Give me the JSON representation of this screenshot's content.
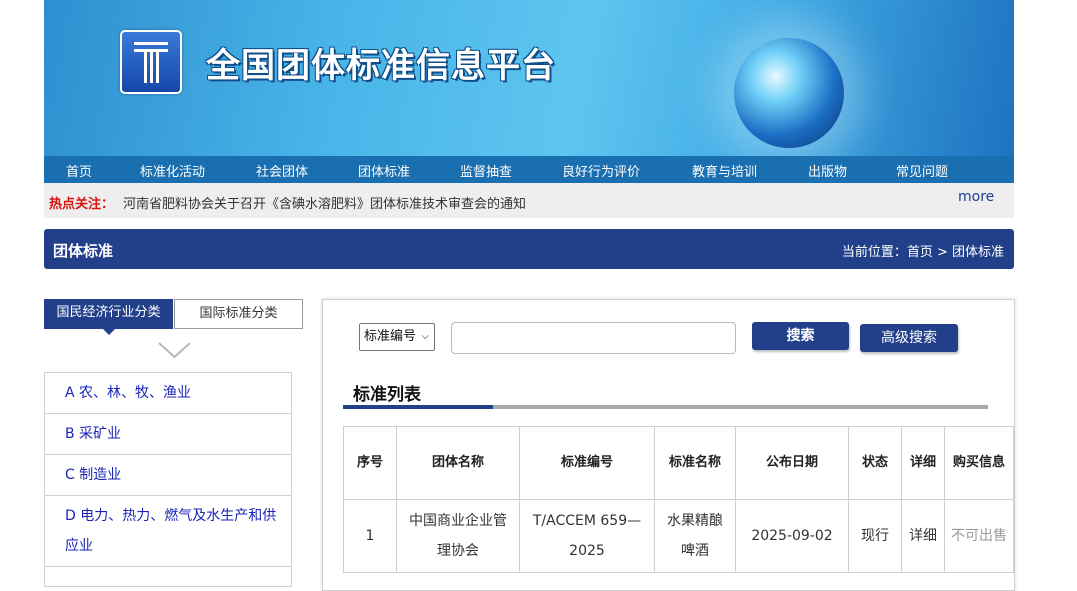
{
  "banner": {
    "site_title": "全国团体标准信息平台"
  },
  "nav": [
    {
      "label": "首页"
    },
    {
      "label": "标准化活动"
    },
    {
      "label": "社会团体"
    },
    {
      "label": "团体标准"
    },
    {
      "label": "监督抽查"
    },
    {
      "label": "良好行为评价"
    },
    {
      "label": "教育与培训"
    },
    {
      "label": "出版物"
    },
    {
      "label": "常见问题"
    }
  ],
  "hot": {
    "label": "热点关注：",
    "text": "河南省肥料协会关于召开《含碘水溶肥料》团体标准技术审查会的通知",
    "more": "more"
  },
  "section": {
    "title": "团体标准",
    "breadcrumb": "当前位置：首页 > 团体标准"
  },
  "sidebar": {
    "tab_active": "国民经济行业分类",
    "tab_other": "国际标准分类",
    "categories": [
      "A 农、林、牧、渔业",
      "B 采矿业",
      "C 制造业",
      "D 电力、热力、燃气及水生产和供应业"
    ]
  },
  "search": {
    "select_value": "标准编号",
    "input_value": "",
    "search_label": "搜索",
    "advanced_label": "高级搜索"
  },
  "list": {
    "title": "标准列表",
    "headers": [
      "序号",
      "团体名称",
      "标准编号",
      "标准名称",
      "公布日期",
      "状态",
      "详细",
      "购买信息"
    ],
    "rows": [
      [
        "1",
        "中国商业企业管理协会",
        "T/ACCEM 659—2025",
        "水果精酿啤酒",
        "2025-09-02",
        "现行",
        "详细",
        "不可出售"
      ]
    ]
  },
  "colors": {
    "primary": "#223f8a",
    "nav": "#1a6fb0",
    "hot": "#d8130f",
    "link": "#1a23b8"
  }
}
